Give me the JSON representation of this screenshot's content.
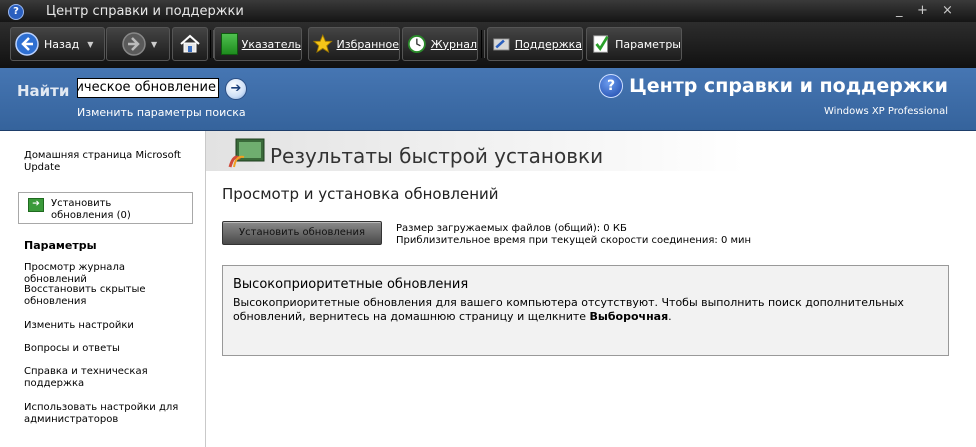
{
  "window": {
    "title": "Центр справки и поддержки",
    "controls": [
      "_",
      "+",
      "×"
    ]
  },
  "toolbar": {
    "back_label": "Назад",
    "index_label": "Указатель",
    "favorites_label": "Избранное",
    "history_label": "Журнал",
    "support_label": "Поддержка",
    "options_label": "Параметры"
  },
  "search": {
    "label": "Найти",
    "value": "Автоматическое обновление",
    "options_link": "Изменить параметры поиска"
  },
  "brand": {
    "title": "Центр справки и поддержки",
    "edition": "Windows XP Professional"
  },
  "sidebar": {
    "home_link": "Домашняя страница Microsoft Update",
    "install_box": {
      "line1": "Установить",
      "line2": "обновления  (0)"
    },
    "heading": "Параметры",
    "items": [
      "Просмотр журнала обновлений",
      "Восстановить скрытые обновления",
      "Изменить настройки",
      "Вопросы и ответы",
      "Справка и техническая поддержка",
      "Использовать настройки для администраторов"
    ]
  },
  "main": {
    "banner_title": "Результаты быстрой установки",
    "subtitle": "Просмотр и установка обновлений",
    "install_button": "Установить обновления",
    "download_size": "Размер загружаемых файлов (общий): 0 КБ",
    "time_estimate": "Приблизительное время при текущей скорости соединения: 0 мин",
    "high_priority": {
      "title": "Высокоприоритетные обновления",
      "text": "Высокоприоритетные обновления для вашего компьютера отсутствуют. Чтобы выполнить поиск дополнительных обновлений, вернитесь на домашнюю страницу и щелкните ",
      "bold": "Выборочная",
      "end": "."
    }
  },
  "colors": {
    "search_bar": "#3c6aa3",
    "toolbar": "#1c1c1c"
  }
}
